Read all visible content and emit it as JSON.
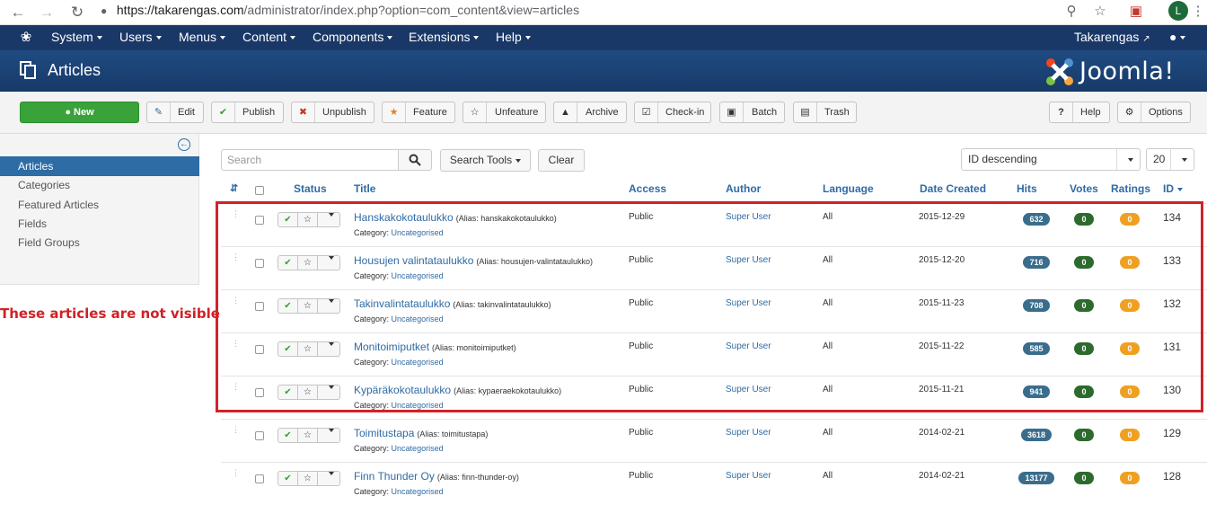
{
  "browser": {
    "url_domain": "https://takarengas.com",
    "url_path": "/administrator/index.php?option=com_content&view=articles",
    "avatar_letter": "L"
  },
  "topnav": {
    "items": [
      "System",
      "Users",
      "Menus",
      "Content",
      "Components",
      "Extensions",
      "Help"
    ],
    "site_name": "Takarengas"
  },
  "header": {
    "title": "Articles",
    "logo_text": "Joomla!"
  },
  "toolbar": {
    "new": "New",
    "edit": "Edit",
    "publish": "Publish",
    "unpublish": "Unpublish",
    "feature": "Feature",
    "unfeature": "Unfeature",
    "archive": "Archive",
    "checkin": "Check-in",
    "batch": "Batch",
    "trash": "Trash",
    "help": "Help",
    "options": "Options"
  },
  "sidebar": {
    "items": [
      "Articles",
      "Categories",
      "Featured Articles",
      "Fields",
      "Field Groups"
    ],
    "active_index": 0
  },
  "annotation": "These articles are not visible",
  "filters": {
    "search_placeholder": "Search",
    "search_tools": "Search Tools",
    "clear": "Clear",
    "ordering": "ID descending",
    "limit": "20"
  },
  "table": {
    "headers": {
      "status": "Status",
      "title": "Title",
      "access": "Access",
      "author": "Author",
      "language": "Language",
      "date_created": "Date Created",
      "hits": "Hits",
      "votes": "Votes",
      "ratings": "Ratings",
      "id": "ID"
    },
    "category_label": "Category:",
    "rows": [
      {
        "title": "Hanskakokotaulukko",
        "alias": "(Alias: hanskakokotaulukko)",
        "category": "Uncategorised",
        "access": "Public",
        "author": "Super User",
        "language": "All",
        "date": "2015-12-29",
        "hits": "632",
        "votes": "0",
        "ratings": "0",
        "id": "134"
      },
      {
        "title": "Housujen valintataulukko",
        "alias": "(Alias: housujen-valintataulukko)",
        "category": "Uncategorised",
        "access": "Public",
        "author": "Super User",
        "language": "All",
        "date": "2015-12-20",
        "hits": "716",
        "votes": "0",
        "ratings": "0",
        "id": "133"
      },
      {
        "title": "Takinvalintataulukko",
        "alias": "(Alias: takinvalintataulukko)",
        "category": "Uncategorised",
        "access": "Public",
        "author": "Super User",
        "language": "All",
        "date": "2015-11-23",
        "hits": "708",
        "votes": "0",
        "ratings": "0",
        "id": "132"
      },
      {
        "title": "Monitoimiputket",
        "alias": "(Alias: monitoimiputket)",
        "category": "Uncategorised",
        "access": "Public",
        "author": "Super User",
        "language": "All",
        "date": "2015-11-22",
        "hits": "585",
        "votes": "0",
        "ratings": "0",
        "id": "131"
      },
      {
        "title": "Kypäräkokotaulukko",
        "alias": "(Alias: kypaeraekokotaulukko)",
        "category": "Uncategorised",
        "access": "Public",
        "author": "Super User",
        "language": "All",
        "date": "2015-11-21",
        "hits": "941",
        "votes": "0",
        "ratings": "0",
        "id": "130"
      },
      {
        "title": "Toimitustapa",
        "alias": "(Alias: toimitustapa)",
        "category": "Uncategorised",
        "access": "Public",
        "author": "Super User",
        "language": "All",
        "date": "2014-02-21",
        "hits": "3618",
        "votes": "0",
        "ratings": "0",
        "id": "129"
      },
      {
        "title": "Finn Thunder Oy",
        "alias": "(Alias: finn-thunder-oy)",
        "category": "Uncategorised",
        "access": "Public",
        "author": "Super User",
        "language": "All",
        "date": "2014-02-21",
        "hits": "13177",
        "votes": "0",
        "ratings": "0",
        "id": "128"
      }
    ]
  },
  "colors": {
    "topnav": "#1a3867",
    "header": "#1e4477",
    "link": "#2f6ba5",
    "new_button": "#3aa23a",
    "hits_badge": "#3a6d8c",
    "votes_badge": "#2d6a2d",
    "ratings_badge": "#f0a020",
    "annotation": "#d02125"
  },
  "icons": {
    "back": "arrow-left-icon",
    "forward": "arrow-right-icon",
    "reload": "reload-icon",
    "lock": "lock-icon",
    "zoom": "zoom-icon",
    "bookmark": "star-icon"
  }
}
